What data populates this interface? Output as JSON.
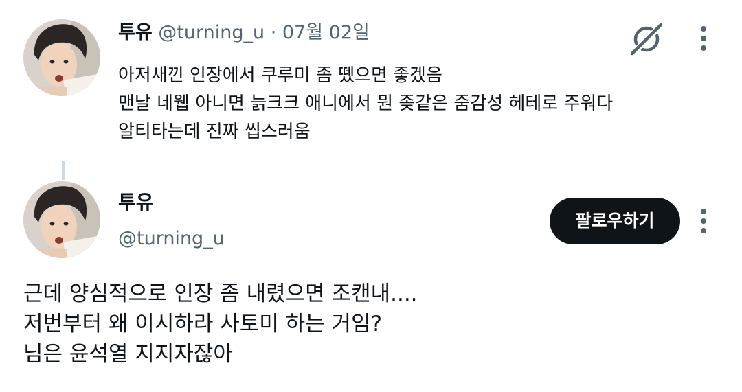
{
  "tweet1": {
    "display_name": "투유",
    "handle": "@turning_u",
    "separator": "·",
    "date": "07월 02일",
    "lines": [
      "아저새낀 인장에서 쿠루미 좀 뗐으면 좋겠음",
      "맨날 네웹 아니면 늙크크 애니에서 뭔 좆같은 줌감성 헤테로 주워다",
      "알티타는데 진짜 씹스러움"
    ],
    "icons": [
      "grok-icon",
      "more-options-icon"
    ]
  },
  "tweet2": {
    "display_name": "투유",
    "handle": "@turning_u",
    "follow_label": "팔로우하기",
    "lines": [
      "근데 양심적으로 인장 좀 내렸으면 조캔내....",
      "저번부터 왜 이시하라 사토미 하는 거임?",
      "님은 윤석열 지지자잖아"
    ],
    "icons": [
      "more-options-icon"
    ]
  },
  "colors": {
    "text": "#0f1419",
    "muted": "#536471",
    "button_bg": "#0f1419",
    "button_text": "#ffffff",
    "thread_line": "#cfd9de"
  }
}
